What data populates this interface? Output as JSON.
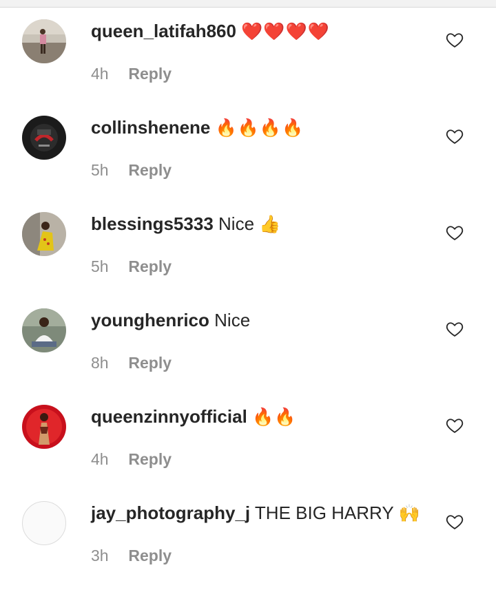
{
  "comments": [
    {
      "username": "queen_latifah860",
      "text": "",
      "emoji": "❤️❤️❤️❤️",
      "time": "4h",
      "reply_label": "Reply"
    },
    {
      "username": "collinshenene",
      "text": "",
      "emoji": "🔥🔥🔥🔥",
      "time": "5h",
      "reply_label": "Reply"
    },
    {
      "username": "blessings5333",
      "text": "Nice",
      "emoji": "👍",
      "time": "5h",
      "reply_label": "Reply"
    },
    {
      "username": "younghenrico",
      "text": "Nice",
      "emoji": "",
      "time": "8h",
      "reply_label": "Reply"
    },
    {
      "username": "queenzinnyofficial",
      "text": "",
      "emoji": "🔥🔥",
      "time": "4h",
      "reply_label": "Reply"
    },
    {
      "username": "jay_photography_j",
      "text": "THE BIG HARRY",
      "emoji": "🙌",
      "time": "3h",
      "reply_label": "Reply"
    }
  ],
  "icons": {
    "like": "heart-outline-icon"
  },
  "colors": {
    "text": "#262626",
    "secondary": "#8e8e8e",
    "background": "#ffffff"
  }
}
